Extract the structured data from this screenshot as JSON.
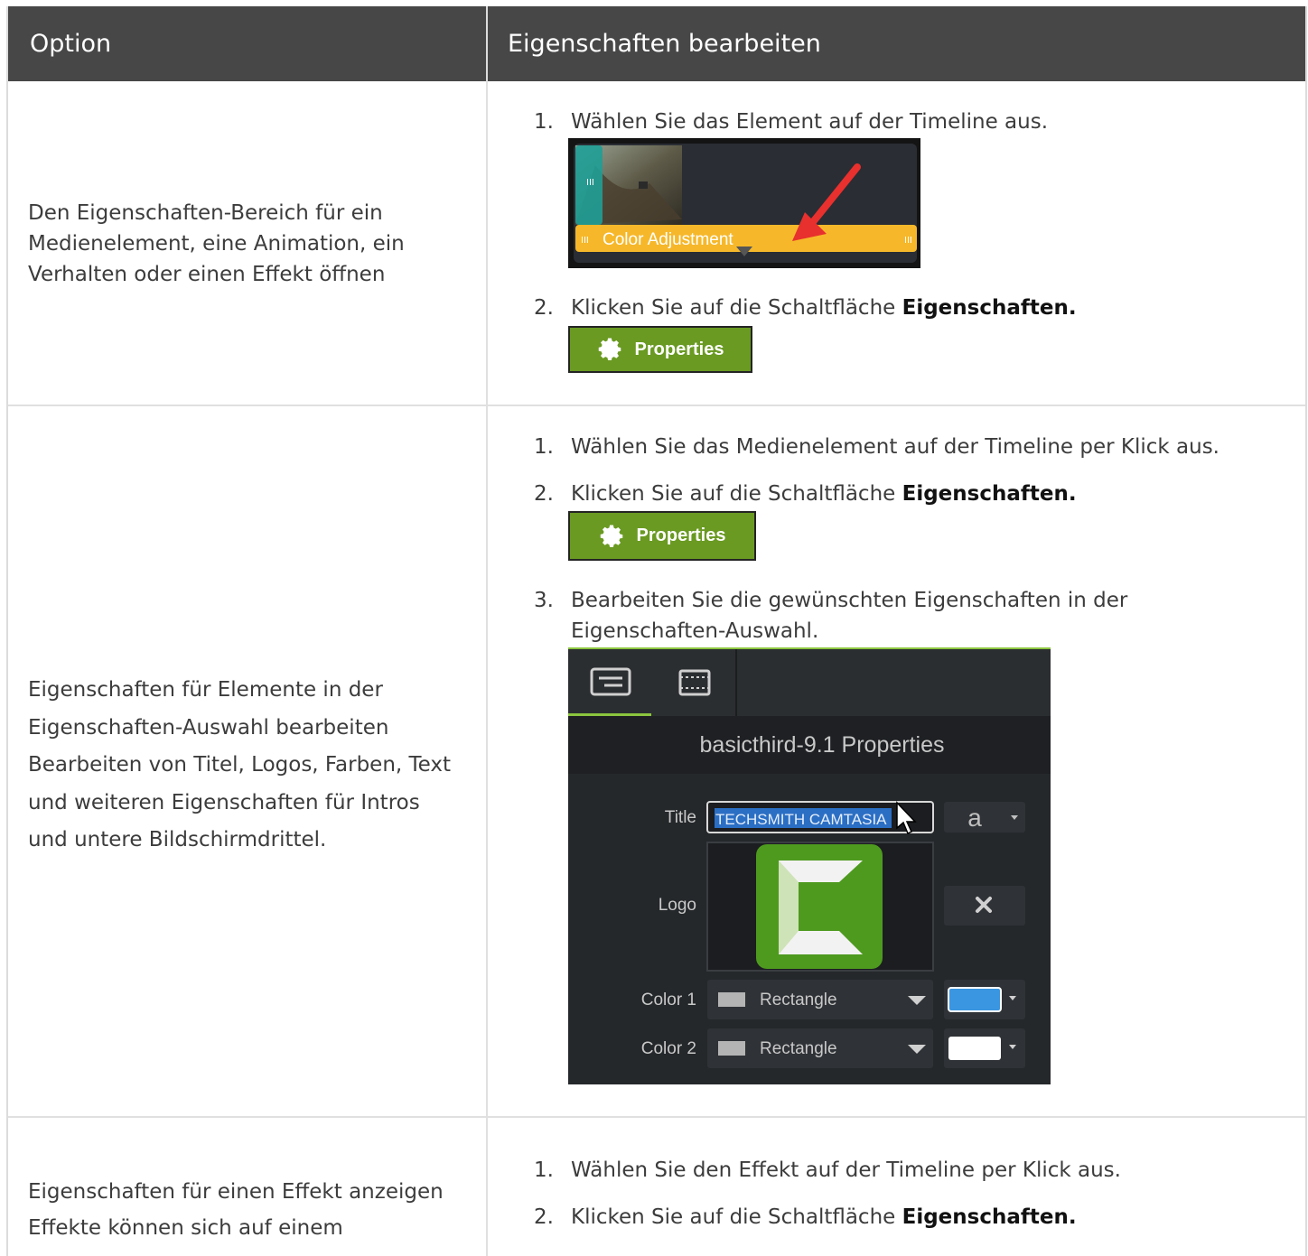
{
  "header": {
    "col1": "Option",
    "col2": "Eigenschaften bearbeiten"
  },
  "rows": [
    {
      "option": "Den Eigenschaften-Bereich für ein Medienelement, eine Animation, ein Verhalten oder einen Effekt öffnen",
      "steps": [
        {
          "num": "1.",
          "text": "Wählen Sie das Element auf der Timeline aus."
        },
        {
          "num": "2.",
          "text": "Klicken Sie auf die Schaltfläche ",
          "bold": "Eigenschaften."
        }
      ],
      "timeline_label": "Color Adjustment",
      "button_label": "Properties"
    },
    {
      "option_lines": [
        "Eigenschaften für Elemente in der",
        "Eigenschaften-Auswahl bearbeiten",
        "Bearbeiten von Titel, Logos, Farben, Text",
        "und weiteren Eigenschaften für Intros",
        "und untere Bildschirmdrittel."
      ],
      "steps": [
        {
          "num": "1.",
          "text": "Wählen Sie das Medienelement auf der Timeline per Klick aus."
        },
        {
          "num": "2.",
          "text": "Klicken Sie auf die Schaltfläche ",
          "bold": "Eigenschaften."
        },
        {
          "num": "3.",
          "text_line1": "Bearbeiten Sie die gewünschten Eigenschaften in der",
          "text_line2": "Eigenschaften-Auswahl."
        }
      ],
      "button_label": "Properties",
      "panel": {
        "title": "basicthird-9.1 Properties",
        "title_label": "Title",
        "title_value": "TECHSMITH CAMTASIA",
        "font_glyph": "a",
        "logo_label": "Logo",
        "color1_label": "Color 1",
        "color2_label": "Color 2",
        "shape1": "Rectangle",
        "shape2": "Rectangle",
        "swatch1": "#3a96e0",
        "swatch2": "#ffffff"
      }
    },
    {
      "option_lines": [
        "Eigenschaften für einen Effekt anzeigen",
        "Effekte können sich auf einem"
      ],
      "steps": [
        {
          "num": "1.",
          "text": "Wählen Sie den Effekt auf der Timeline per Klick aus."
        },
        {
          "num": "2.",
          "text": "Klicken Sie auf die Schaltfläche ",
          "bold": "Eigenschaften."
        }
      ]
    }
  ],
  "colors": {
    "header_bg": "#474747",
    "button_green": "#6a9a22",
    "clip_yellow": "#f6b82a",
    "teal": "#1f9e96",
    "arrow_red": "#e8302e"
  }
}
